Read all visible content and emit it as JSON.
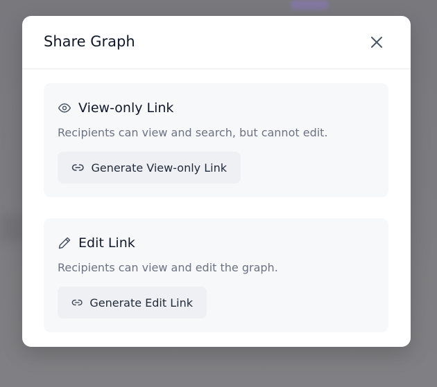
{
  "modal": {
    "title": "Share Graph",
    "close_icon": "close-icon"
  },
  "view_only": {
    "icon": "eye-icon",
    "title": "View-only Link",
    "description": "Recipients can view and search, but cannot edit.",
    "button_icon": "link-icon",
    "button_label": "Generate View-only Link"
  },
  "edit": {
    "icon": "pencil-icon",
    "title": "Edit Link",
    "description": "Recipients can view and edit the graph.",
    "button_icon": "link-icon",
    "button_label": "Generate Edit Link"
  },
  "colors": {
    "title_text": "#111827",
    "muted_text": "#6b7280",
    "card_bg": "#f7f8fa",
    "button_bg": "#eef0f4",
    "icon_stroke": "#4b5563",
    "backdrop": "#7b7b7f"
  }
}
